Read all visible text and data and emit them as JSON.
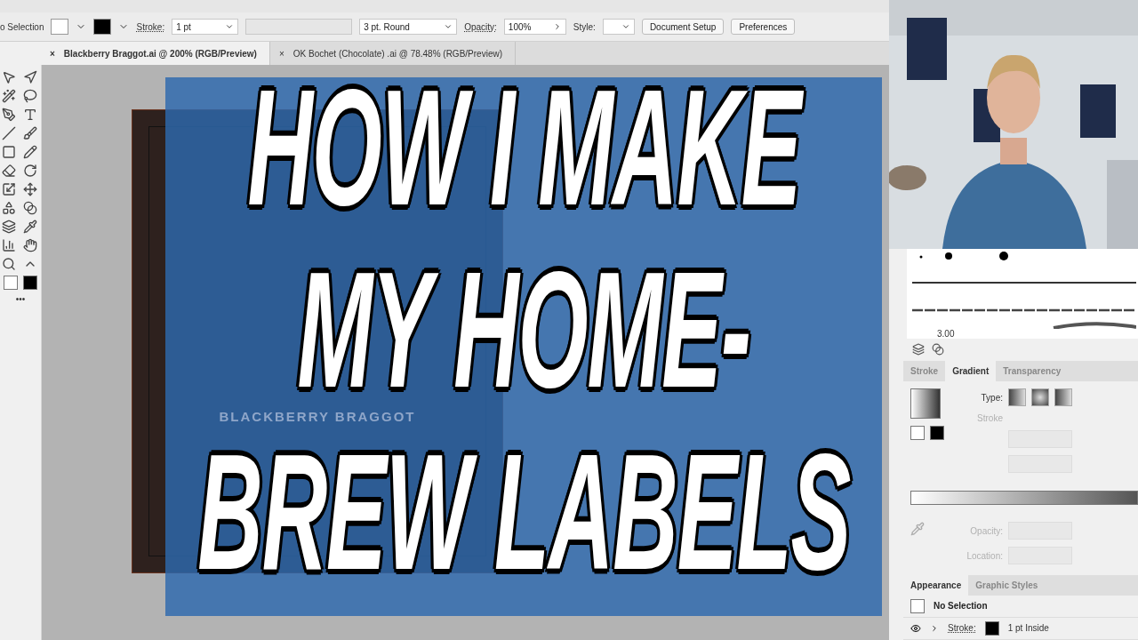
{
  "control_bar": {
    "selection": "o Selection",
    "stroke_label": "Stroke:",
    "stroke_weight": "1 pt",
    "brush": "3 pt. Round",
    "opacity_label": "Opacity:",
    "opacity": "100%",
    "style_label": "Style:",
    "buttons": [
      "Document Setup",
      "Preferences"
    ]
  },
  "document_tabs": [
    {
      "close": "×",
      "label": "Blackberry Braggot.ai @ 200% (RGB/Preview)",
      "selected": true
    },
    {
      "close": "×",
      "label": "OK Bochet (Chocolate) .ai @ 78.48% (RGB/Preview)",
      "selected": false
    }
  ],
  "toolbar": {
    "more": "•••"
  },
  "artboard": {
    "banner": "BLACKBERRY BRAGGOT"
  },
  "headline": [
    "HOW I MAKE",
    "MY HOME-",
    "BREW LABELS"
  ],
  "brushes": {
    "size": "3.00"
  },
  "panel_tabs": [
    {
      "label": "Stroke",
      "selected": false
    },
    {
      "label": "Gradient",
      "selected": true
    },
    {
      "label": "Transparency",
      "selected": false
    }
  ],
  "gradient": {
    "type_label": "Type:",
    "fields": [
      {
        "label": "Stroke",
        "disabled": true
      },
      {
        "label": "Opacity:",
        "disabled": true
      },
      {
        "label": "Location:",
        "disabled": true
      }
    ]
  },
  "appearance_tabs": [
    {
      "label": "Appearance",
      "selected": true
    },
    {
      "label": "Graphic Styles",
      "selected": false
    }
  ],
  "appearance": {
    "title": "No Selection",
    "rows": [
      {
        "label": "Stroke:",
        "value": "1 pt Inside"
      }
    ]
  }
}
